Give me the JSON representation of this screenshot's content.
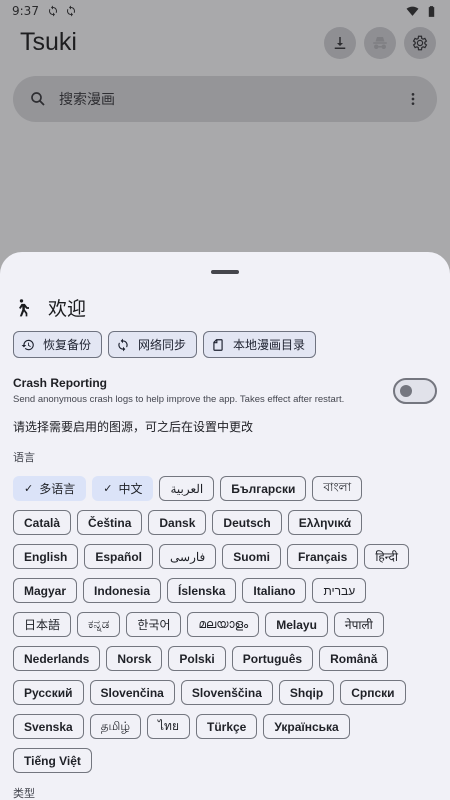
{
  "status": {
    "time": "9:37"
  },
  "app": {
    "title": "Tsuki"
  },
  "search": {
    "placeholder": "搜索漫画"
  },
  "sheet": {
    "title": "欢迎",
    "actions": [
      {
        "label": "恢复备份",
        "icon": "restore-icon"
      },
      {
        "label": "网络同步",
        "icon": "sync-icon"
      },
      {
        "label": "本地漫画目录",
        "icon": "folder-file-icon"
      }
    ],
    "crash": {
      "title": "Crash Reporting",
      "description": "Send anonymous crash logs to help improve the app. Takes effect after restart.",
      "enabled": false
    },
    "hint": "请选择需要启用的图源，可之后在设置中更改",
    "language_label": "语言",
    "languages": [
      [
        {
          "label": "多语言",
          "selected": true
        },
        {
          "label": "中文",
          "selected": true
        },
        {
          "label": "العربية",
          "light": true
        },
        {
          "label": "Български"
        },
        {
          "label": "বাংলা",
          "light": true
        }
      ],
      [
        {
          "label": "Català"
        },
        {
          "label": "Čeština"
        },
        {
          "label": "Dansk"
        },
        {
          "label": "Deutsch"
        },
        {
          "label": "Ελληνικά"
        }
      ],
      [
        {
          "label": "English"
        },
        {
          "label": "Español"
        },
        {
          "label": "فارسی",
          "light": true
        },
        {
          "label": "Suomi"
        },
        {
          "label": "Français"
        },
        {
          "label": "हिन्दी",
          "light": true
        }
      ],
      [
        {
          "label": "Magyar"
        },
        {
          "label": "Indonesia"
        },
        {
          "label": "Íslenska"
        },
        {
          "label": "Italiano"
        },
        {
          "label": "עברית",
          "light": true
        }
      ],
      [
        {
          "label": "日本語",
          "light": true
        },
        {
          "label": "ಕನ್ನಡ",
          "light": true
        },
        {
          "label": "한국어",
          "light": true
        },
        {
          "label": "മലയാളം",
          "light": true
        },
        {
          "label": "Melayu"
        },
        {
          "label": "नेपाली",
          "light": true
        }
      ],
      [
        {
          "label": "Nederlands"
        },
        {
          "label": "Norsk"
        },
        {
          "label": "Polski"
        },
        {
          "label": "Português"
        },
        {
          "label": "Română"
        }
      ],
      [
        {
          "label": "Русский"
        },
        {
          "label": "Slovenčina"
        },
        {
          "label": "Slovenščina"
        },
        {
          "label": "Shqip"
        },
        {
          "label": "Српски"
        }
      ],
      [
        {
          "label": "Svenska"
        },
        {
          "label": "தமிழ்",
          "light": true
        },
        {
          "label": "ไทย",
          "light": true
        },
        {
          "label": "Türkçe"
        },
        {
          "label": "Українська"
        }
      ],
      [
        {
          "label": "Tiếng Việt"
        }
      ]
    ],
    "type_label": "类型"
  }
}
